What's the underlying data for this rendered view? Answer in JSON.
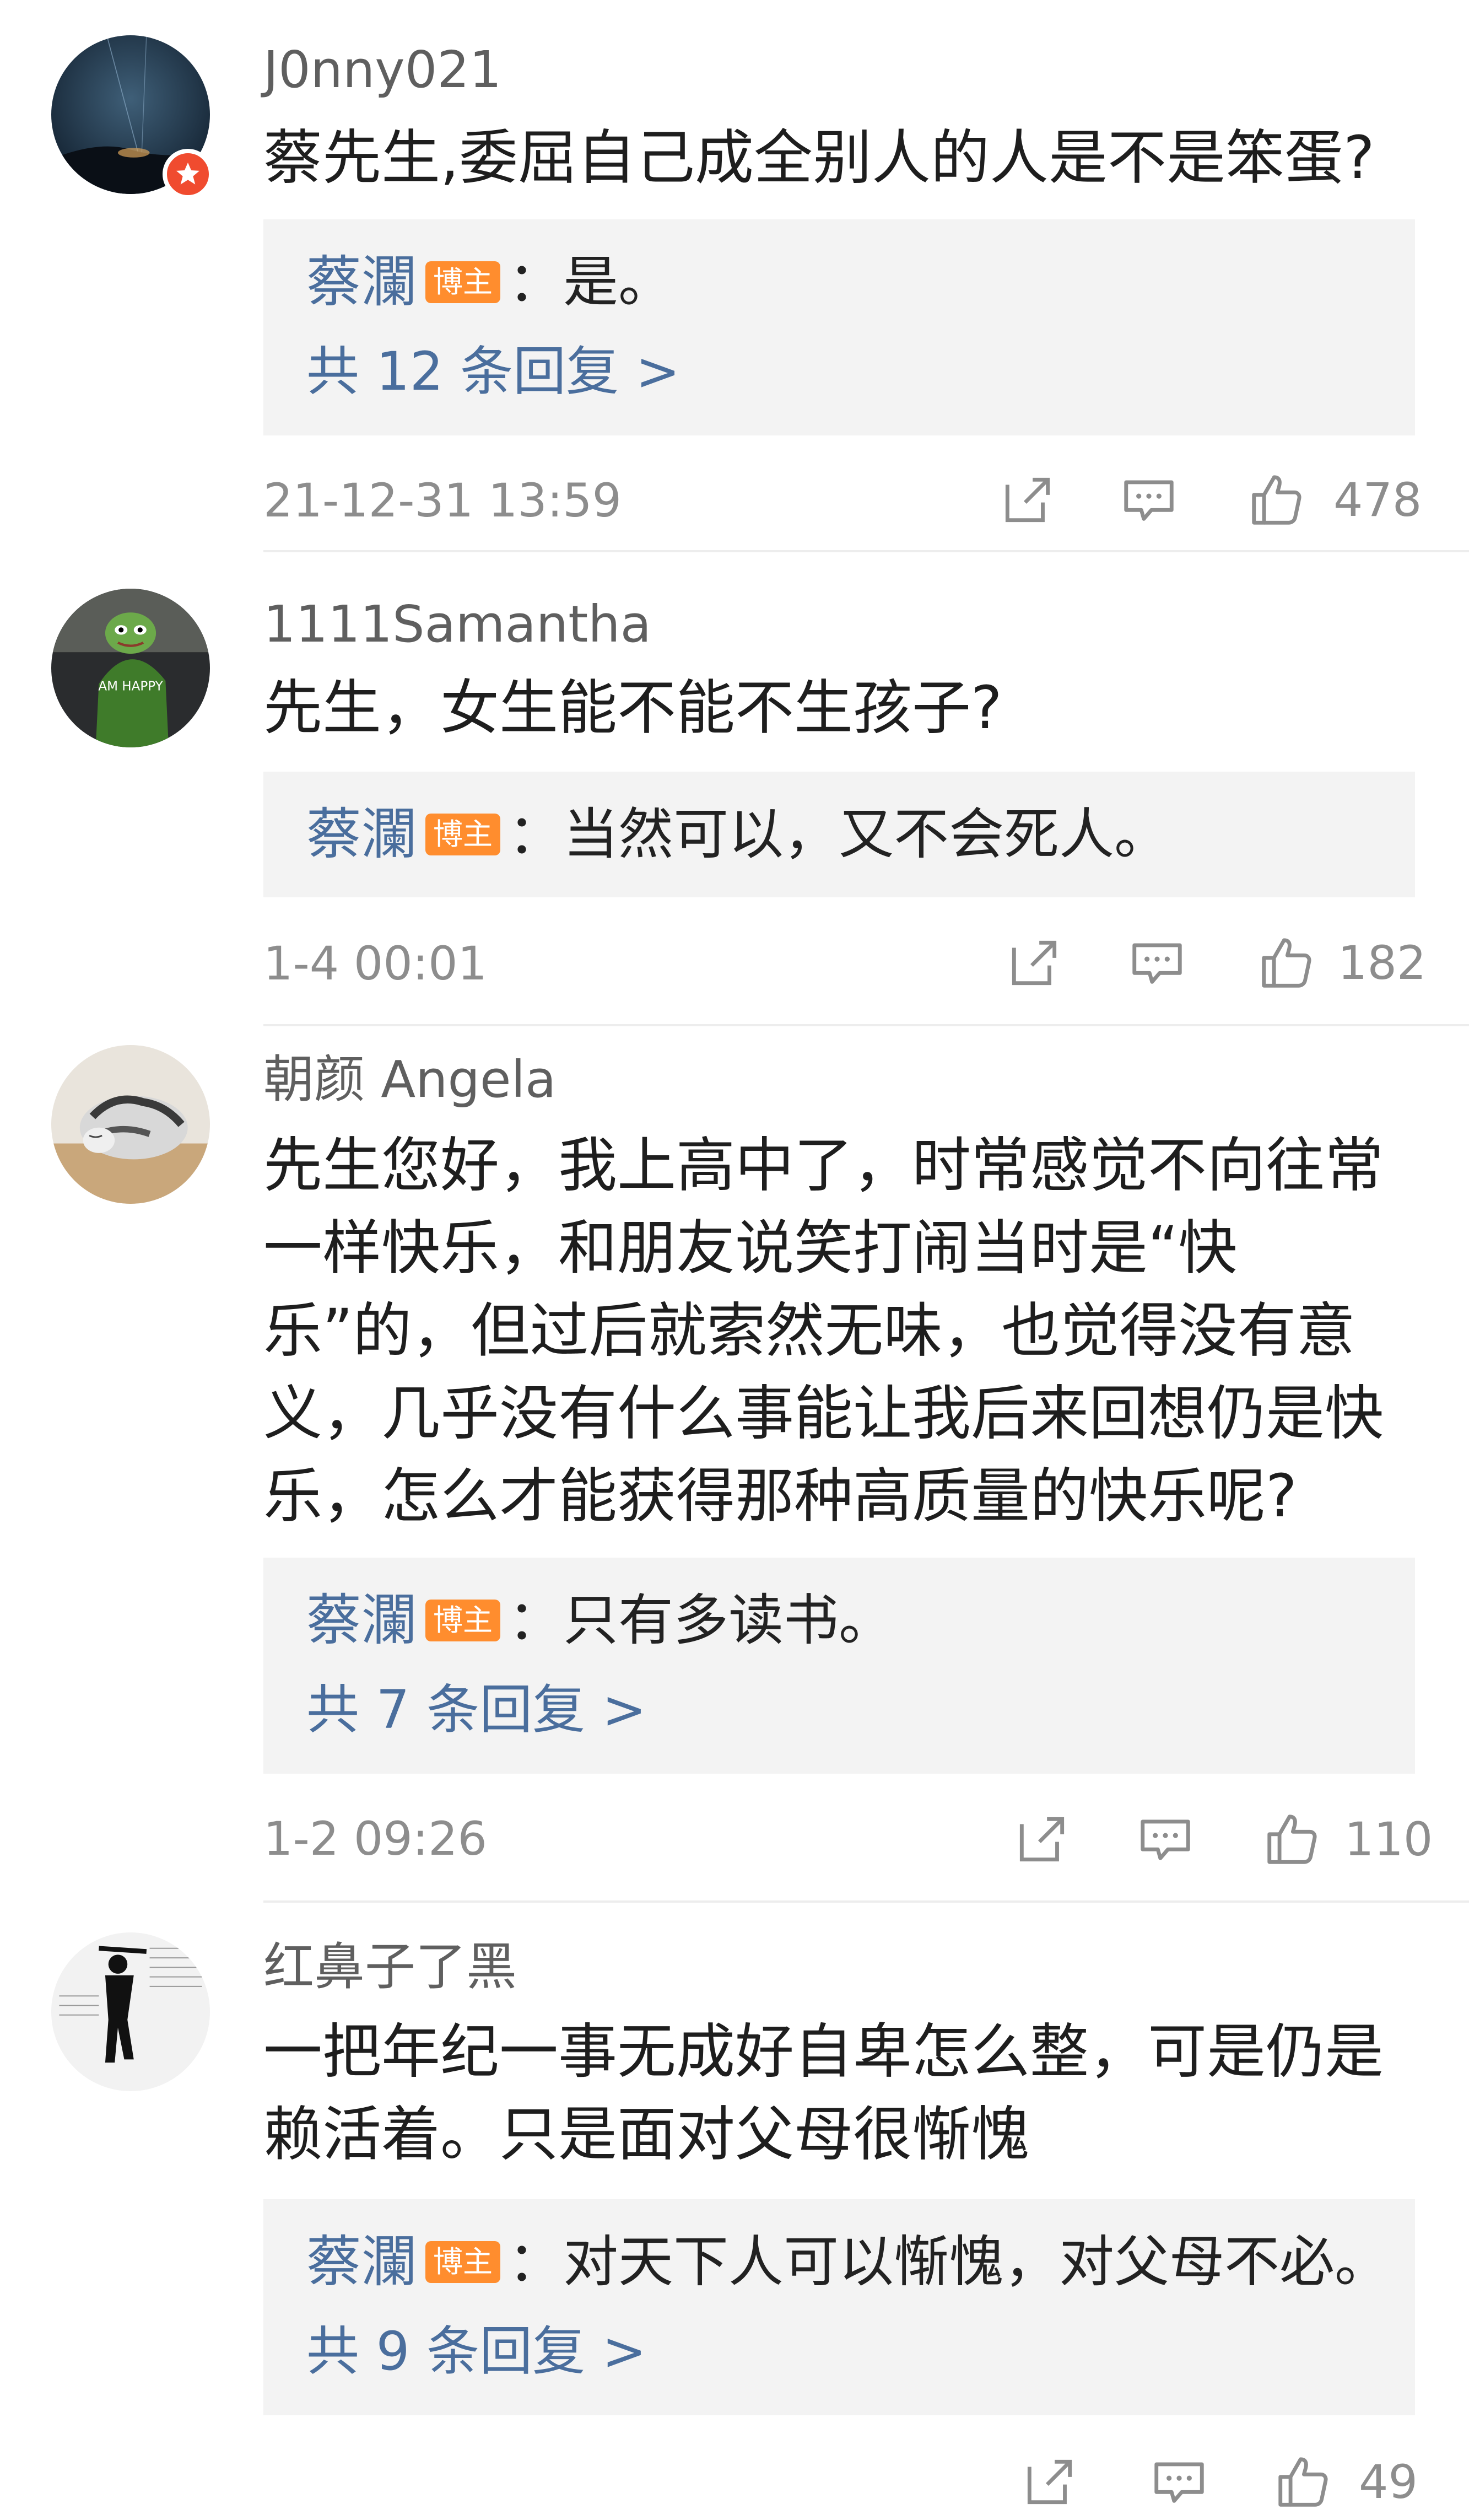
{
  "comments": [
    {
      "username": "J0nny021",
      "text": "蔡先生,委屈自己成全别人的人是不是笨蛋?",
      "verified": true,
      "reply": {
        "author": "蔡瀾",
        "badge": "博主",
        "text": "：是。",
        "more": "共 12 条回复 >"
      },
      "time": "21-12-31 13:59",
      "likes": "478"
    },
    {
      "username": "1111Samantha",
      "text": "先生，女生能不能不生孩子?",
      "avatar_text": "AM HAPPY",
      "reply": {
        "author": "蔡瀾",
        "badge": "博主",
        "text": "：当然可以，又不会死人。"
      },
      "time": "1-4 00:01",
      "likes": "182"
    },
    {
      "username": "朝颜 Angela",
      "text": "先生您好，我上高中了，时常感觉不向往常一样快乐，和朋友说笑打闹当时是“快乐”的，但过后就索然无味，也觉得没有意义，几乎没有什么事能让我后来回想仍是快乐，怎么才能获得那种高质量的快乐呢?",
      "reply": {
        "author": "蔡瀾",
        "badge": "博主",
        "text": "：只有多读书。",
        "more": "共 7 条回复 >"
      },
      "time": "1-2 09:26",
      "likes": "110"
    },
    {
      "username": "红鼻子了黑",
      "text": "一把年纪一事无成好自卑怎么整，可是仍是赖活着。只是面对父母很惭愧",
      "reply": {
        "author": "蔡瀾",
        "badge": "博主",
        "text": "：对天下人可以惭愧，对父母不必。",
        "more": "共 9 条回复 >"
      },
      "time": "",
      "likes": "49"
    }
  ],
  "icons": {
    "share": "share-icon",
    "comment": "comment-icon",
    "like": "like-icon",
    "verified": "verified-badge-icon"
  },
  "colors": {
    "link": "#4a6e9d",
    "badge": "#ff8d2e",
    "reply_bg": "#f3f3f3",
    "meta": "#8d8d8d",
    "verified": "#f04b2f"
  }
}
